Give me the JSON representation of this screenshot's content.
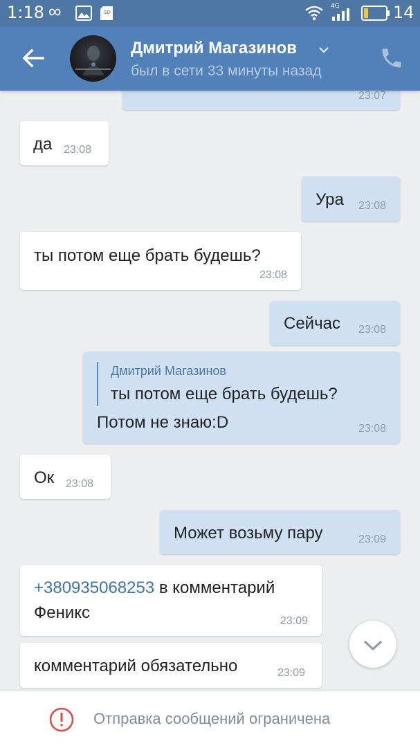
{
  "status_bar": {
    "time": "1:18",
    "battery_level": "14",
    "network_label": "4G"
  },
  "header": {
    "contact_name": "Дмитрий Магазинов",
    "contact_status": "был в сети 33 минуты назад"
  },
  "messages": [
    {
      "direction": "out",
      "text": "",
      "time": "23:07"
    },
    {
      "direction": "in",
      "text": "да",
      "time": "23:08"
    },
    {
      "direction": "out",
      "text": "Ура",
      "time": "23:08"
    },
    {
      "direction": "in",
      "text": "ты потом еще брать будешь?",
      "time": "23:08"
    },
    {
      "direction": "out",
      "text": "Сейчас",
      "time": "23:08"
    },
    {
      "direction": "out",
      "reply": {
        "author": "Дмитрий Магазинов",
        "text": "ты потом еще брать будешь?"
      },
      "text": "Потом не знаю:D",
      "time": "23:08"
    },
    {
      "direction": "in",
      "text": "Ок",
      "time": "23:08"
    },
    {
      "direction": "out",
      "text": "Может возьму пару",
      "time": "23:09"
    },
    {
      "direction": "in",
      "phone": "+380935068253",
      "text_after_phone": " в комментарий",
      "text_line2": "Феникс",
      "time": "23:09"
    },
    {
      "direction": "in",
      "text": "комментарий обязательно",
      "time": "23:09"
    }
  ],
  "bottom_bar": {
    "notice": "Отправка сообщений ограничена"
  },
  "colors": {
    "header": "#5181b8",
    "status_bar": "#4f77a6",
    "outgoing_bubble": "#cfe0f3",
    "incoming_bubble": "#ffffff",
    "background": "#edeef0",
    "restriction_icon": "#e64646"
  }
}
